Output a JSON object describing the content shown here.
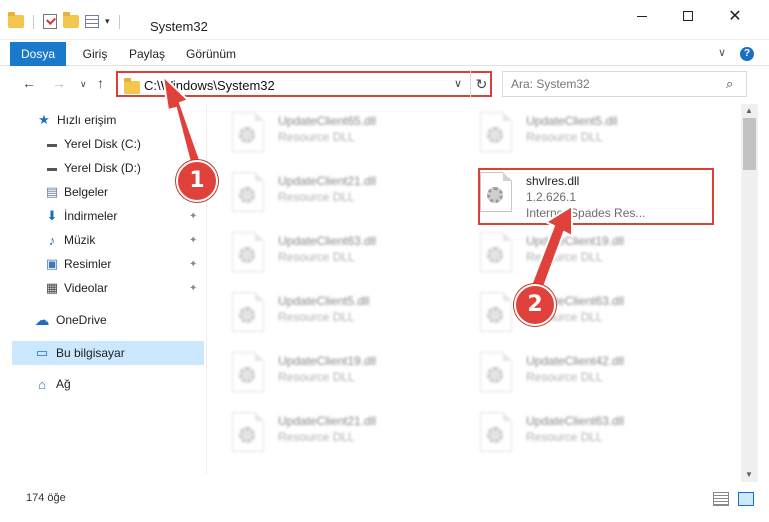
{
  "window": {
    "title": "System32",
    "minimize_icon": "minimize-icon",
    "maximize_icon": "maximize-icon",
    "close_symbol": "✕"
  },
  "ribbon": {
    "tabs": [
      "Dosya",
      "Giriş",
      "Paylaş",
      "Görünüm"
    ],
    "file_tab_color": "#1979ca",
    "help_label": "?"
  },
  "address": {
    "path": "C:\\Windows\\System32",
    "dropdown": "∨",
    "refresh": "↻"
  },
  "nav": {
    "back": "←",
    "forward": "→",
    "recent": "∨",
    "up": "↑"
  },
  "search": {
    "placeholder": "Ara: System32",
    "icon": "🔍"
  },
  "sidebar": {
    "items": [
      {
        "label": "Hızlı erişim",
        "icon": "star-icon",
        "glyph": "★"
      },
      {
        "label": "Yerel Disk (C:)",
        "icon": "drive-icon",
        "glyph": "▬",
        "pinned": true
      },
      {
        "label": "Yerel Disk (D:)",
        "icon": "drive-icon",
        "glyph": "▬"
      },
      {
        "label": "Belgeler",
        "icon": "documents-icon",
        "glyph": "▤"
      },
      {
        "label": "İndirmeler",
        "icon": "download-icon",
        "glyph": "⬇",
        "pinned": true
      },
      {
        "label": "Müzik",
        "icon": "music-icon",
        "glyph": "♪",
        "pinned": true
      },
      {
        "label": "Resimler",
        "icon": "pictures-icon",
        "glyph": "▣",
        "pinned": true
      },
      {
        "label": "Videolar",
        "icon": "videos-icon",
        "glyph": "▦",
        "pinned": true
      },
      {
        "label": "OneDrive",
        "icon": "cloud-icon",
        "glyph": "☁"
      },
      {
        "label": "Bu bilgisayar",
        "icon": "computer-icon",
        "glyph": "▭",
        "selected": true
      },
      {
        "label": "Ağ",
        "icon": "network-icon",
        "glyph": "⌂"
      }
    ],
    "pin_glyph": "📌"
  },
  "files": {
    "left_column": [
      {
        "name": "UpdateClient65.dll",
        "desc": "Resource DLL"
      },
      {
        "name": "UpdateClient21.dll",
        "desc": "Resource DLL"
      },
      {
        "name": "UpdateClient63.dll",
        "desc": "Resource DLL"
      },
      {
        "name": "UpdateClient5.dll",
        "desc": "Resource DLL"
      },
      {
        "name": "UpdateClient19.dll",
        "desc": "Resource DLL"
      },
      {
        "name": "UpdateClient21.dll",
        "desc": "Resource DLL"
      }
    ],
    "right_column": [
      {
        "name": "UpdateClient5.dll",
        "desc": "Resource DLL"
      },
      {
        "name": "shvlres.dll",
        "version": "1.2.626.1",
        "desc": "Internet Spades Res...",
        "highlighted": true
      },
      {
        "name": "UpdateClient19.dll",
        "desc": "Resource DLL"
      },
      {
        "name": "UpdateClient63.dll",
        "desc": "Resource DLL"
      },
      {
        "name": "UpdateClient42.dll",
        "desc": "Resource DLL"
      },
      {
        "name": "UpdateClient63.dll",
        "desc": "Resource DLL"
      }
    ]
  },
  "status": {
    "count": "174 öğe"
  },
  "callouts": {
    "one": "1",
    "two": "2",
    "color": "#e0413b"
  }
}
